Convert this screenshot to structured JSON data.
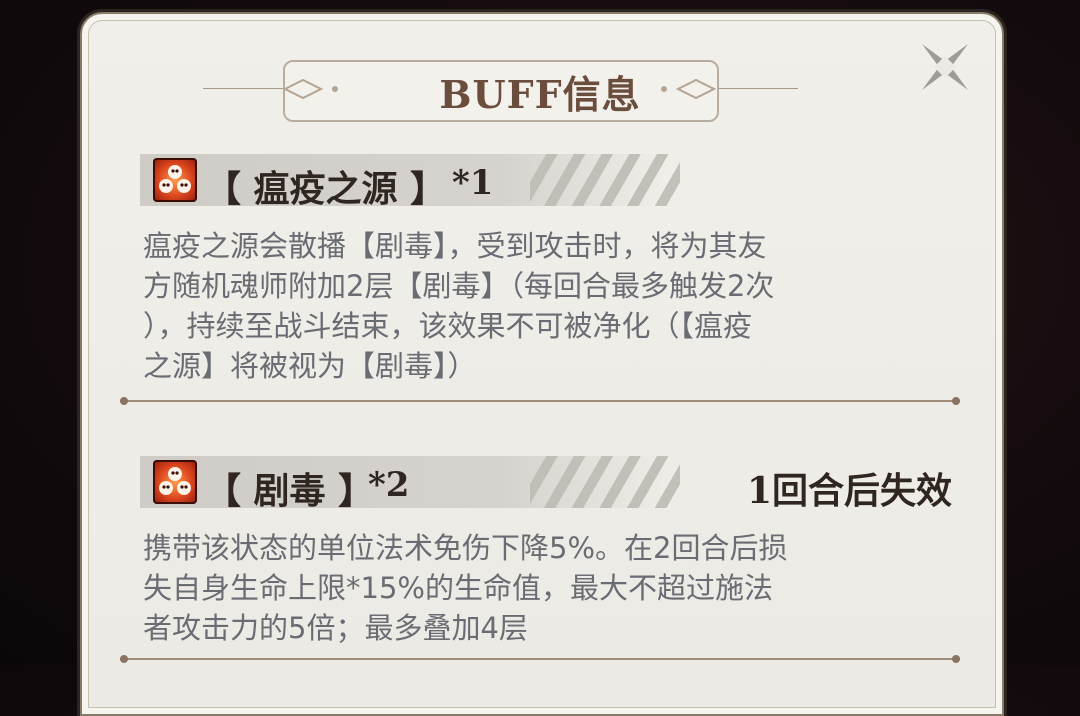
{
  "title": "BUFF信息",
  "buffs": [
    {
      "name": "【 瘟疫之源 】",
      "count": "*1",
      "expire": "",
      "icon": "skull-cluster-icon",
      "description_lines": [
        "瘟疫之源会散播【剧毒】，受到攻击时，将为其友",
        "方随机魂师附加2层【剧毒】（每回合最多触发2次",
        "），持续至战斗结束，该效果不可被净化（【瘟疫",
        "之源】将被视为【剧毒】）"
      ]
    },
    {
      "name": "【 剧毒 】",
      "count": "*2",
      "expire": "1回合后失效",
      "icon": "skull-cluster-icon",
      "description_lines": [
        "携带该状态的单位法术免伤下降5%。在2回合后损",
        "失自身生命上限*15%的生命值，最大不超过施法",
        "者攻击力的5倍；最多叠加4层"
      ]
    }
  ],
  "colors": {
    "title": "#6b4d3d",
    "text": "#2f2622",
    "description": "#6a6c73",
    "panel": "#eceae4",
    "icon": "#d9431c"
  }
}
